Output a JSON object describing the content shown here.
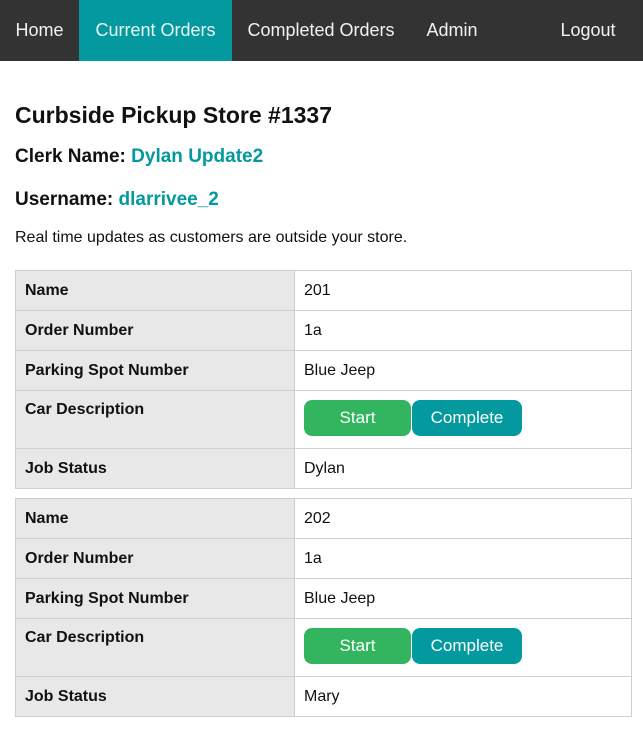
{
  "nav": {
    "home": "Home",
    "current_orders": "Current Orders",
    "completed_orders": "Completed Orders",
    "admin": "Admin",
    "logout": "Logout"
  },
  "store_title": "Curbside Pickup Store #1337",
  "clerk": {
    "label": "Clerk Name:",
    "value": "Dylan Update2"
  },
  "username": {
    "label": "Username:",
    "value": "dlarrivee_2"
  },
  "intro": "Real time updates as customers are outside your store.",
  "labels": {
    "name": "Name",
    "order_number": "Order Number",
    "parking_spot": "Parking Spot Number",
    "car_description": "Car Description",
    "job_status": "Job Status"
  },
  "buttons": {
    "start": "Start",
    "complete": "Complete"
  },
  "orders": [
    {
      "name": "201",
      "order_number": "1a",
      "parking_spot": "Blue Jeep",
      "job_status": "Dylan"
    },
    {
      "name": "202",
      "order_number": "1a",
      "parking_spot": "Blue Jeep",
      "job_status": "Mary"
    }
  ],
  "colors": {
    "navbar": "#333333",
    "accent": "#04999e",
    "start": "#33b55f"
  }
}
